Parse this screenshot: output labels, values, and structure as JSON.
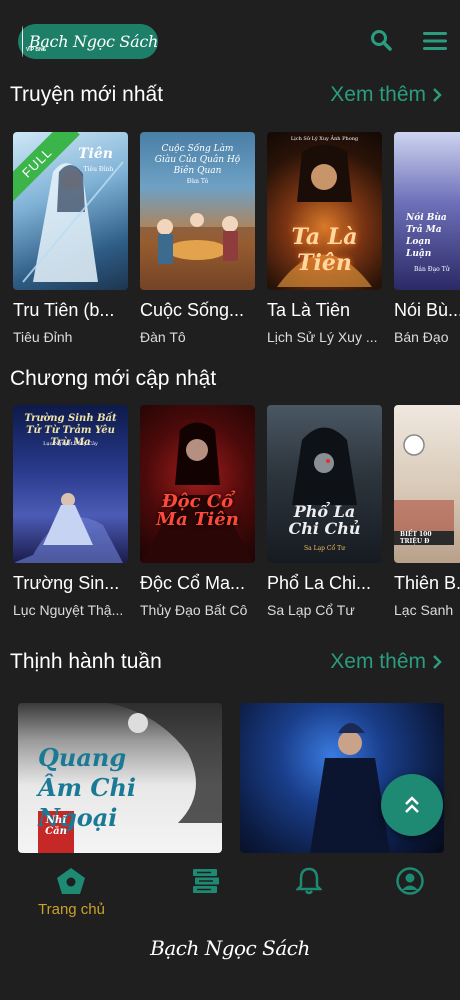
{
  "header": {
    "logo_text": "Bạch Ngọc Sách",
    "logo_sub": "VIP BNS",
    "search_icon": "search-icon",
    "menu_icon": "hamburger-menu-icon"
  },
  "sections": {
    "new_stories": {
      "title": "Truyện mới nhất",
      "see_more": "Xem thêm"
    },
    "new_chapters": {
      "title": "Chương mới cập nhật"
    },
    "weekly_trending": {
      "title": "Thịnh hành tuần",
      "see_more": "Xem thêm"
    }
  },
  "new_stories": [
    {
      "title": "Tru Tiên (b...",
      "author": "Tiêu Đỉnh",
      "badge": "FULL",
      "cover_text": "Tiên",
      "cover_sub": "Tiêu Đỉnh"
    },
    {
      "title": "Cuộc Sống...",
      "author": "Đàn Tô",
      "cover_text": "Cuộc Sống Làm Giàu Của Quân Hộ Biên Quan",
      "cover_sub": "Đàn Tô"
    },
    {
      "title": "Ta Là Tiên",
      "author": "Lịch Sử Lý Xuy ...",
      "cover_text": "Ta Là Tiên",
      "cover_sub": "Lịch Sử Lý Xuy Ảnh Phong"
    },
    {
      "title": "Nói Bù...",
      "author": "Bán Đạo",
      "cover_text": "Nói Bùa Trả Ma Loạn Luận",
      "cover_sub": "Bán Đạo Tử"
    }
  ],
  "new_chapters": [
    {
      "title": "Trường Sin...",
      "author": "Lục Nguyệt Thậ...",
      "cover_text": "Trường Sinh Bất Tử Từ Trảm Yêu Trừ Ma",
      "cover_sub": "Lục Nguyệt Thấy Cây"
    },
    {
      "title": "Độc Cổ Ma...",
      "author": "Thủy Đạo Bất Cô",
      "cover_text": "Độc Cổ Ma Tiên",
      "cover_sub": ""
    },
    {
      "title": "Phổ La Chi...",
      "author": "Sa Lạp Cổ Tư",
      "cover_text": "Phổ La Chi Chủ",
      "cover_sub": "Sa Lạp Cổ Tư"
    },
    {
      "title": "Thiên B...",
      "author": "Lạc Sanh",
      "cover_text": "BIẾT 100 TRIỆU Đ",
      "cover_sub": ""
    }
  ],
  "weekly_trending": [
    {
      "cover_text": "Quang Âm Chi Ngoại",
      "cover_sub": "Nhĩ Căn"
    },
    {
      "cover_text": ""
    }
  ],
  "bottom_nav": {
    "home_label": "Trang chủ",
    "home_icon": "home-icon",
    "library_icon": "books-icon",
    "notification_icon": "bell-icon",
    "profile_icon": "user-icon"
  },
  "footer": {
    "brand": "Bạch Ngọc Sách"
  },
  "colors": {
    "accent": "#2a9d7f",
    "background": "#1f1f1f",
    "active_nav": "#c9a227",
    "fab": "#1e8a73"
  }
}
